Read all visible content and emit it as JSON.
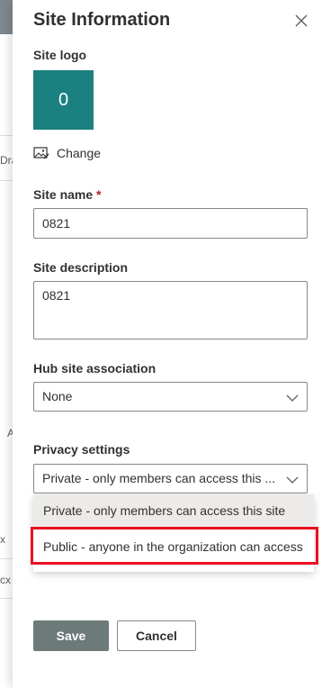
{
  "background": {
    "fragments": [
      "Dra",
      "A",
      "x",
      "cx"
    ]
  },
  "panel": {
    "title": "Site Information",
    "close_icon": "close-icon"
  },
  "logo": {
    "label": "Site logo",
    "letter": "0",
    "tile_color": "#1a8080",
    "change_label": "Change",
    "change_icon": "image-edit-icon"
  },
  "site_name": {
    "label": "Site name",
    "required_marker": "*",
    "value": "0821"
  },
  "site_description": {
    "label": "Site description",
    "value": "0821"
  },
  "hub": {
    "label": "Hub site association",
    "value": "None"
  },
  "privacy": {
    "label": "Privacy settings",
    "value": "Private - only members can access this ...",
    "options": [
      "Private - only members can access this site",
      "Public - anyone in the organization can access"
    ],
    "highlight_color": "#e81123"
  },
  "buttons": {
    "save": "Save",
    "cancel": "Cancel"
  }
}
